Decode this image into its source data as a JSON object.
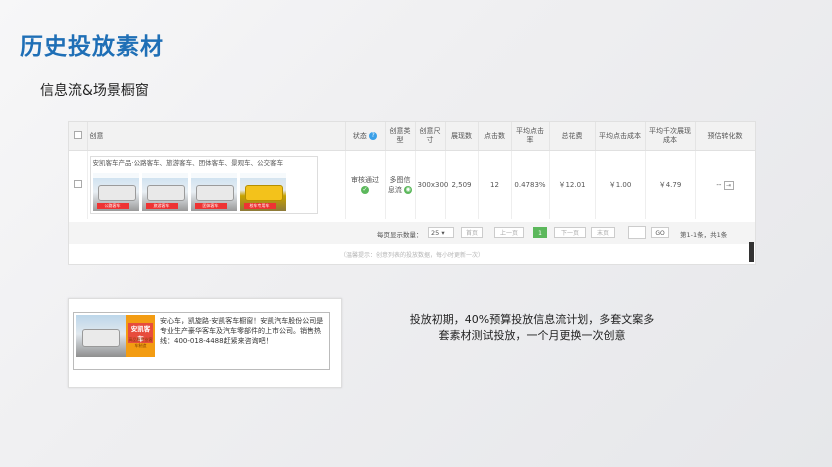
{
  "page": {
    "title": "历史投放素材",
    "subtitle": "信息流&场景橱窗"
  },
  "table": {
    "headers": {
      "creative": "创意",
      "status": "状态",
      "creative_type": "创意类型",
      "creative_size": "创意尺寸",
      "impressions": "展现数",
      "clicks": "点击数",
      "avg_ctr": "平均点击率",
      "total_cost": "总花费",
      "avg_cpc": "平均点击成本",
      "avg_cpm": "平均千次展现成本",
      "conversions": "预估转化数"
    },
    "row": {
      "creative_title": "安凯客车产品·公路客车、旅游客车、团体客车、景观车、公交客车",
      "image_captions": [
        "公路客车",
        "旅游客车",
        "团体客车",
        "校车专用车"
      ],
      "status": "审核通过",
      "type": "多图信息流",
      "size": "300x300",
      "impressions": "2,509",
      "clicks": "12",
      "ctr": "0.4783%",
      "cost": "￥12.01",
      "cpc": "￥1.00",
      "cpm": "￥4.79",
      "conv": "--"
    }
  },
  "pager": {
    "page_size_label": "每页显示数量：",
    "page_size": "25",
    "first": "首页",
    "prev": "上一页",
    "current": "1",
    "next": "下一页",
    "last": "末页",
    "go": "GO",
    "summary": "第1-1条，共1条",
    "footnote": "（温馨提示：创意列表的投放数据，每小时更新一次）"
  },
  "ad_preview": {
    "badge_line1": "安凯客车",
    "badge_line2": "高品质专业客车制造",
    "text": "安心车，凯旋路·安凯客车橱窗！安凯汽车股份公司是专业生产豪华客车及汽车零部件的上市公司。销售热线：400-018-4488赶紧来咨询吧！"
  },
  "description": {
    "line1": "投放初期，40%预算投放信息流计划，多套文案多",
    "line2": "套素材测试投放，一个月更换一次创意"
  }
}
